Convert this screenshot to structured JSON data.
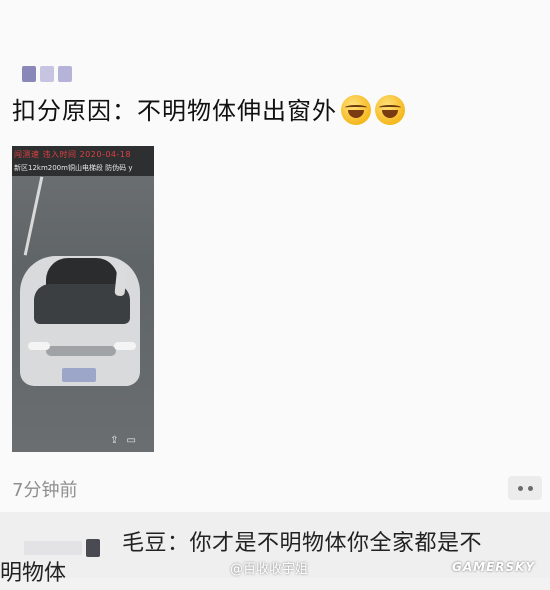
{
  "post": {
    "text": "扣分原因：不明物体伸出窗外",
    "emojis": [
      "laugh-cry-emoji",
      "laugh-cry-emoji"
    ],
    "photo": {
      "line1": "闯测速  违入时间  2020-04-18",
      "line2": "新区12km200m铜山电梯段 防伪码 y"
    },
    "time": "7分钟前"
  },
  "comment": {
    "text": "毛豆：你才是不明物体你全家都是不",
    "text_wrap": "明物体"
  },
  "watermarks": {
    "weibo": "@百收收宇姐",
    "site": "GAMERSKY"
  },
  "colors": {
    "background": "#fafafa",
    "time_text": "#8f8f8f",
    "photo_red_text": "#e04040"
  }
}
